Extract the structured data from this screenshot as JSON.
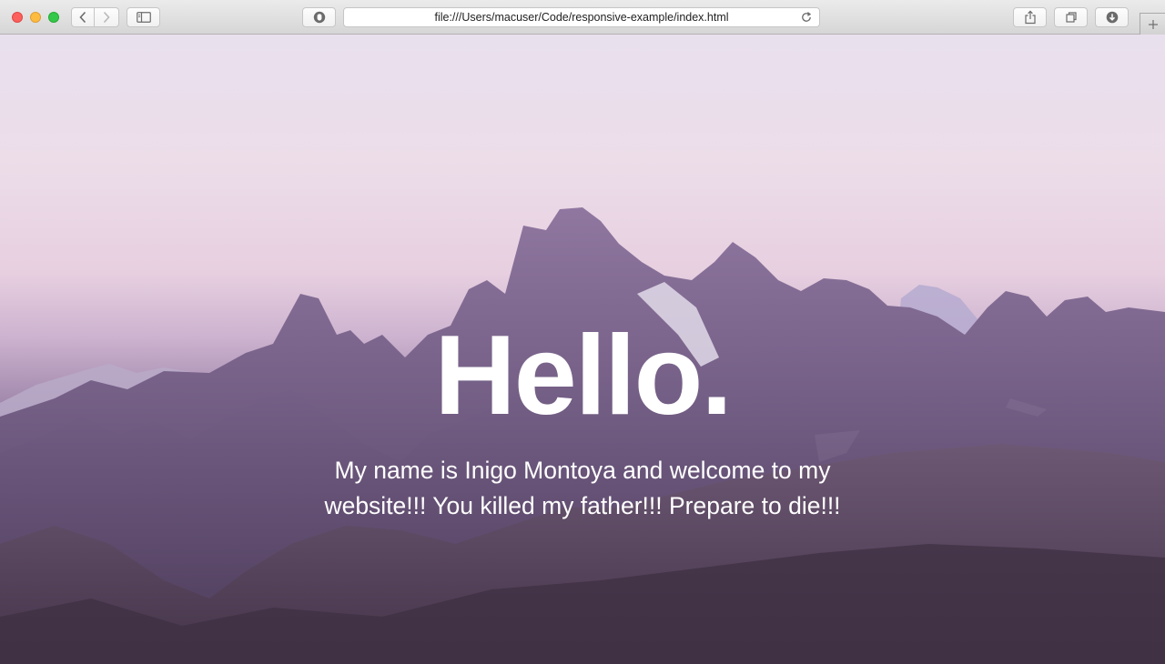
{
  "browser": {
    "address_url": "file:///Users/macuser/Code/responsive-example/index.html",
    "icons": {
      "back": "chevron-left-icon",
      "forward": "chevron-right-icon",
      "sidebar": "sidebar-icon",
      "privacy": "shield-icon",
      "reload": "reload-icon",
      "share": "share-icon",
      "tabs": "tabs-overview-icon",
      "download": "download-icon",
      "new_tab": "plus-icon"
    },
    "colors": {
      "close": "#fc605c",
      "minimize": "#fdbc40",
      "zoom": "#34c84a"
    }
  },
  "hero": {
    "title": "Hello.",
    "text": "My name is Inigo Montoya and welcome to my website!!! You killed my father!!! Prepare to die!!!"
  }
}
